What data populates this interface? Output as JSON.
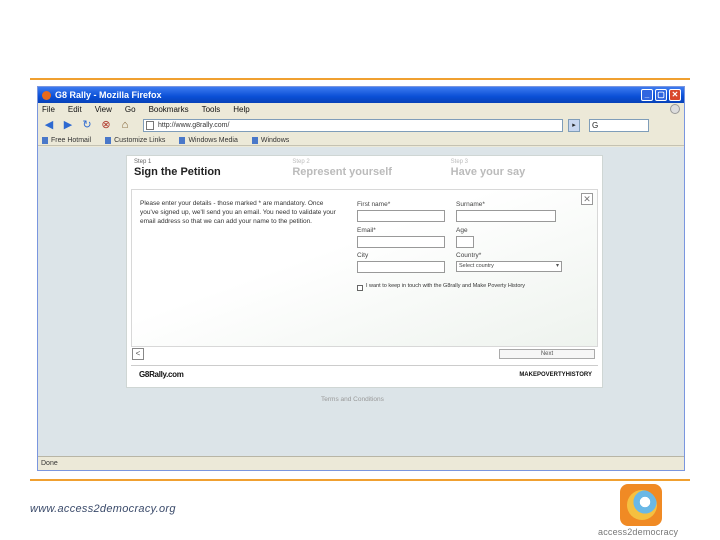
{
  "browser": {
    "window_title": "G8 Rally - Mozilla Firefox",
    "window_buttons": [
      "_",
      "▢",
      "✕"
    ],
    "menu": [
      "File",
      "Edit",
      "View",
      "Go",
      "Bookmarks",
      "Tools",
      "Help"
    ],
    "url": "http://www.g8rally.com/",
    "url_go": "▸",
    "search_placeholder": "G",
    "bookmarks": [
      "Free Hotmail",
      "Customize Links",
      "Windows Media",
      "Windows"
    ],
    "status": "Done"
  },
  "petition": {
    "steps": [
      {
        "num": "Step 1",
        "title": "Sign the Petition"
      },
      {
        "num": "Step 2",
        "title": "Represent yourself"
      },
      {
        "num": "Step 3",
        "title": "Have your say"
      }
    ],
    "intro": "Please enter your details - those marked * are mandatory. Once you've signed up, we'll send you an email. You need to validate your email address so that we can add your name to the petition.",
    "labels": {
      "first_name": "First name*",
      "surname": "Surname*",
      "email": "Email*",
      "age": "Age",
      "city": "City",
      "country": "Country*"
    },
    "country_value": "Select country",
    "checkbox_label": "I want to keep in touch with the G8rally and Make Poverty History",
    "next_label": "Next",
    "prev_label": "<",
    "close_label": "✕",
    "g8_logo": "G8Rally.com",
    "mph_logo": "MAKEPOVERTYHISTORY",
    "terms": "Terms and Conditions"
  },
  "footer": {
    "site_url": "www.access2democracy.org",
    "logo_text": "access2democracy"
  },
  "colors": {
    "rule": "#f0a030",
    "titlebar": "#0a4fd6",
    "logo_orange": "#f08a24"
  }
}
